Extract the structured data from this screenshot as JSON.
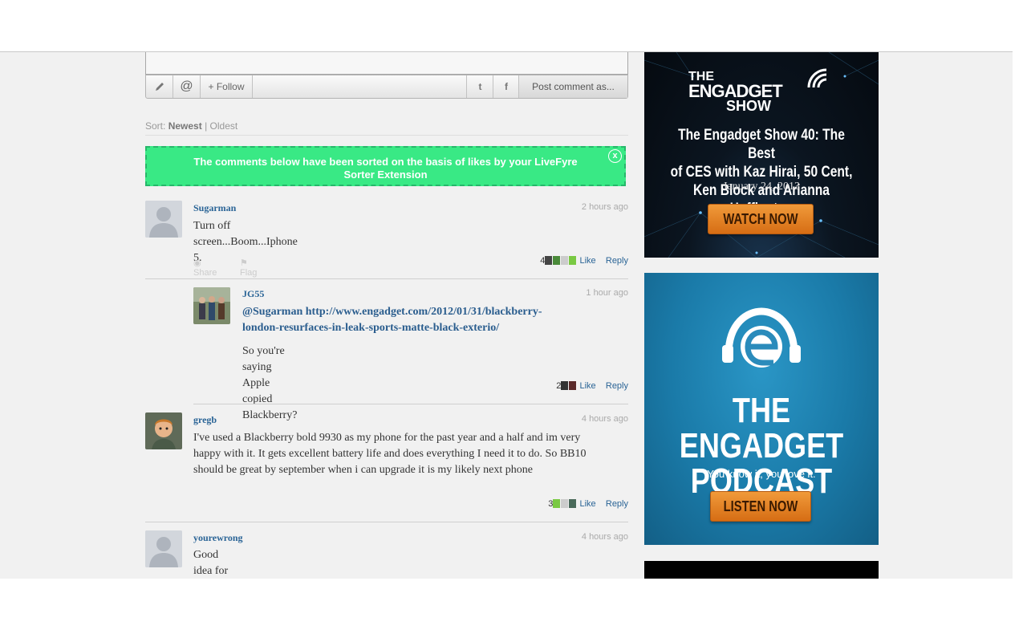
{
  "composer": {
    "follow_label": "+ Follow",
    "post_label": "Post comment as..."
  },
  "sort": {
    "prefix": "Sort:",
    "newest": "Newest",
    "separator": "|",
    "oldest": "Oldest"
  },
  "banner": {
    "text_line1": "The comments below have been sorted on the basis of likes by your LiveFyre",
    "text_line2": "Sorter Extension",
    "close_label": "x"
  },
  "comments": [
    {
      "author": "Sugarman",
      "time": "2 hours ago",
      "text": "Turn off screen...Boom...Iphone 5.",
      "likes": "4",
      "like_label": "Like",
      "reply_label": "Reply",
      "share_label": "Share",
      "flag_label": "Flag"
    },
    {
      "author": "JG55",
      "time": "1 hour ago",
      "mention": "@Sugarman",
      "link_text": "http://www.engadget.com/2012/01/31/blackberry-london-resurfaces-in-leak-sports-matte-black-exterio/",
      "link_line1": "http://www.engadget.com/2012/01/31/blackberry-",
      "link_line2": "london-resurfaces-in-leak-sports-matte-black-exterio/",
      "text": "So you're saying Apple copied Blackberry?",
      "likes": "2",
      "like_label": "Like",
      "reply_label": "Reply"
    },
    {
      "author": "gregb",
      "time": "4 hours ago",
      "text_line1": "I've used a Blackberry bold 9930 as my phone for the past year and a half and im very",
      "text_line2": "happy with it. It gets excellent battery life and does everything  I need it to do. So BB10",
      "text_line3": "should be great by september when i can upgrade it is my likely next phone",
      "likes": "3",
      "like_label": "Like",
      "reply_label": "Reply"
    },
    {
      "author": "yourewrong",
      "time": "4 hours ago",
      "text": "Good idea for articles. Looking forward to your reports!"
    }
  ],
  "ads": {
    "show": {
      "logo_line1": "THE",
      "logo_line2": "ENGADGET",
      "logo_line3": "SHOW",
      "title_line1": "The Engadget Show 40: The Best",
      "title_line2": "of CES with Kaz Hirai, 50 Cent,",
      "title_line3": "Ken Block and Arianna Huffington",
      "date": "January 24, 2013",
      "button": "WATCH NOW"
    },
    "podcast": {
      "title_line1": "THE ENGADGET",
      "title_line2": "PODCAST",
      "tagline": "You know it, you love it.",
      "button": "LISTEN NOW"
    }
  }
}
